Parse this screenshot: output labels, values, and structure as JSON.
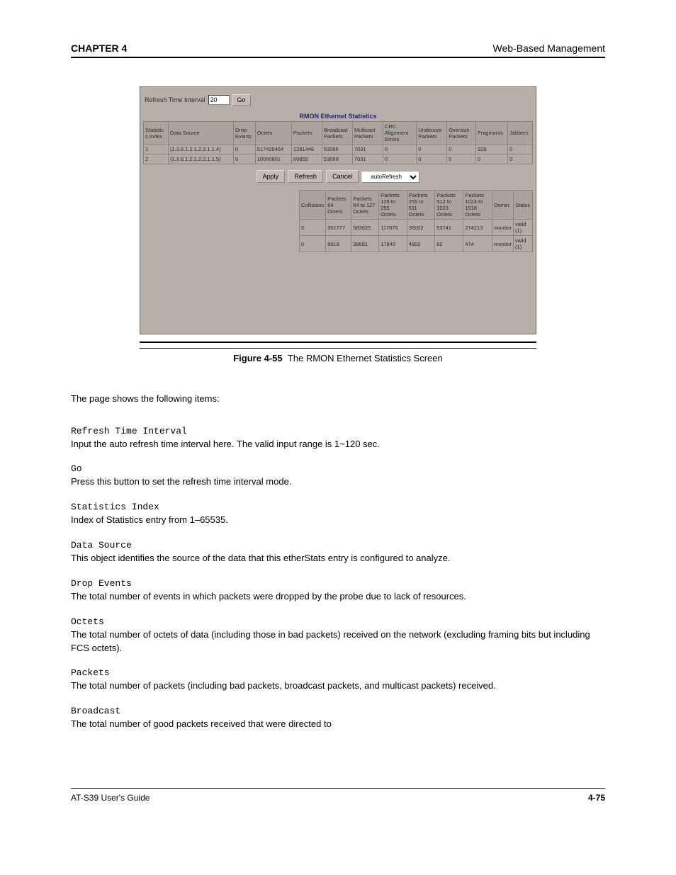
{
  "header": {
    "left": "CHAPTER 4",
    "right": "Web-Based Management"
  },
  "ui": {
    "refresh_label": "Refresh Time Interval",
    "refresh_value": "20",
    "go_label": "Go",
    "title": "RMON Ethernet Statistics",
    "buttons": {
      "apply": "Apply",
      "refresh": "Refresh",
      "cancel": "Cancel",
      "mode": "autoRefresh"
    },
    "table1": {
      "headers": [
        "Statistics Index",
        "Data Source",
        "Drop Events",
        "Octets",
        "Packets",
        "Broadcast Packets",
        "Multicast Packets",
        "CRC Alignment Errors",
        "Undersize Packets",
        "Oversize Packets",
        "Fragments",
        "Jabbers"
      ],
      "rows": [
        [
          "1",
          "{1.3.6.1.2.1.2.2.1.1.4}",
          "0",
          "517429464",
          "1281448",
          "53086",
          "7031",
          "0",
          "0",
          "0",
          "928",
          "0"
        ],
        [
          "2",
          "{1.3.6.1.2.1.2.2.1.1.5}",
          "0",
          "10060601",
          "60859",
          "53089",
          "7031",
          "0",
          "0",
          "0",
          "0",
          "0"
        ]
      ]
    },
    "table2": {
      "headers": [
        "Collisions",
        "Packets 64 Octets",
        "Packets 64 to 127 Octets",
        "Packets 128 to 255 Octets",
        "Packets 256 to 511 Octets",
        "Packets 512 to 1023 Octets",
        "Packets 1024 to 1518 Octets",
        "Owner",
        "Status"
      ],
      "rows": [
        [
          "5",
          "361777",
          "583629",
          "117075",
          "36002",
          "53741",
          "274213",
          "monitor",
          "valid (1)"
        ],
        [
          "0",
          "8018",
          "39681",
          "17843",
          "4902",
          "82",
          "474",
          "monitor",
          "valid (1)"
        ]
      ]
    }
  },
  "fig": {
    "label": "Figure 4-55",
    "caption": "The RMON Ethernet Statistics Screen"
  },
  "intro": "The page shows the following items:",
  "params": [
    {
      "term": "Refresh Time Interval",
      "desc": "Input the auto refresh time interval here. The valid input range is 1~120 sec."
    },
    {
      "term": "Go",
      "desc": "Press this button to set the refresh time interval mode."
    },
    {
      "term": "Statistics Index",
      "desc": "Index of Statistics entry from 1–65535."
    },
    {
      "term": "Data Source",
      "desc": "This object identifies the source of the data that this etherStats entry is configured to analyze."
    },
    {
      "term": "Drop Events",
      "desc": "The total number of events in which packets were dropped by the probe due to lack of resources."
    },
    {
      "term": "Octets",
      "desc": "The total number of octets of data (including those in bad packets) received on the network (excluding framing bits but including FCS octets)."
    },
    {
      "term": "Packets",
      "desc": "The total number of packets (including bad packets, broadcast packets, and multicast packets) received."
    },
    {
      "term": "Broadcast",
      "desc": "The total number of good packets received that were directed to"
    }
  ],
  "footer": {
    "left": "AT-S39 User's Guide",
    "page": "4-75"
  }
}
